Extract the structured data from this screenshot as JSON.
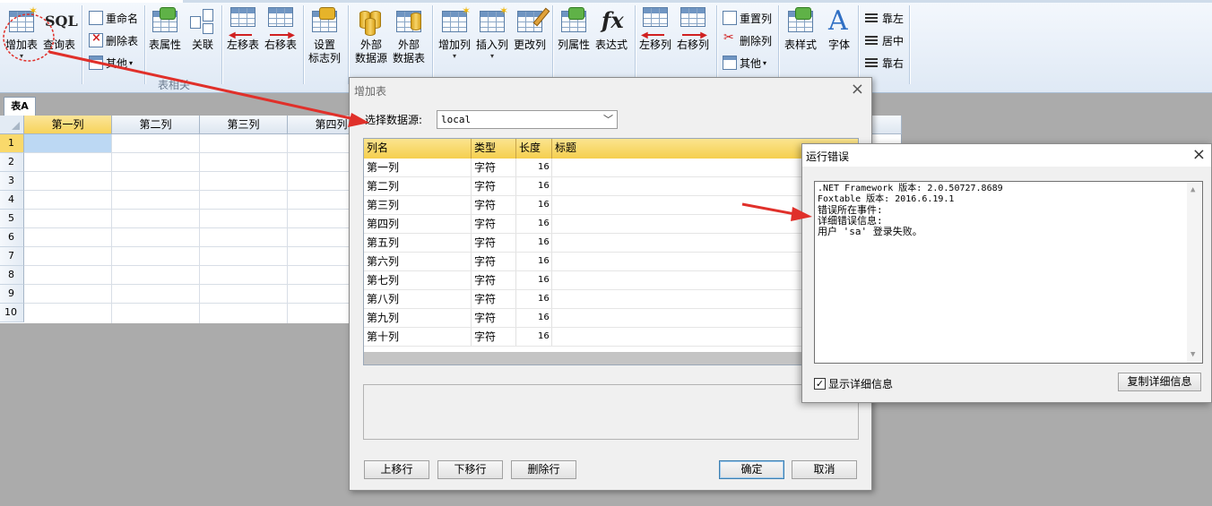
{
  "ribbon": {
    "add_table": "增加表",
    "query_table": "查询表",
    "sql_icon_text": "SQL",
    "rename": "重命名",
    "delete_table": "删除表",
    "other_1": "其他",
    "table_props": "表属性",
    "relation": "关联",
    "move_table_left": "左移表",
    "move_table_right": "右移表",
    "set_flag_col_1": "设置",
    "set_flag_col_2": "标志列",
    "external_source_1": "外部",
    "external_source_2": "数据源",
    "external_table_1": "外部",
    "external_table_2": "数据表",
    "add_column": "增加列",
    "insert_column": "插入列",
    "change_column": "更改列",
    "column_props": "列属性",
    "expression": "表达式",
    "fx_icon_text": "fx",
    "move_col_left": "左移列",
    "move_col_right": "右移列",
    "reset_columns": "重置列",
    "delete_column": "删除列",
    "other_2": "其他",
    "table_style": "表样式",
    "font": "字体",
    "font_icon_text": "A",
    "align_left": "靠左",
    "align_center": "居中",
    "align_right": "靠右",
    "group_table_related": "表相关"
  },
  "sheet": {
    "tab": "表A",
    "columns": [
      "第一列",
      "第二列",
      "第三列",
      "第四列"
    ],
    "rows": [
      "1",
      "2",
      "3",
      "4",
      "5",
      "6",
      "7",
      "8",
      "9",
      "10"
    ]
  },
  "add_table_dialog": {
    "title": "增加表",
    "source_label": "选择数据源:",
    "source_value": "local",
    "headers": [
      "列名",
      "类型",
      "长度",
      "标题"
    ],
    "rows": [
      {
        "name": "第一列",
        "type": "字符",
        "len": "16",
        "title": ""
      },
      {
        "name": "第二列",
        "type": "字符",
        "len": "16",
        "title": ""
      },
      {
        "name": "第三列",
        "type": "字符",
        "len": "16",
        "title": ""
      },
      {
        "name": "第四列",
        "type": "字符",
        "len": "16",
        "title": ""
      },
      {
        "name": "第五列",
        "type": "字符",
        "len": "16",
        "title": ""
      },
      {
        "name": "第六列",
        "type": "字符",
        "len": "16",
        "title": ""
      },
      {
        "name": "第七列",
        "type": "字符",
        "len": "16",
        "title": ""
      },
      {
        "name": "第八列",
        "type": "字符",
        "len": "16",
        "title": ""
      },
      {
        "name": "第九列",
        "type": "字符",
        "len": "16",
        "title": ""
      },
      {
        "name": "第十列",
        "type": "字符",
        "len": "16",
        "title": ""
      }
    ],
    "btn_move_up": "上移行",
    "btn_move_down": "下移行",
    "btn_delete_row": "删除行",
    "btn_ok": "确定",
    "btn_cancel": "取消"
  },
  "error_dialog": {
    "title": "运行错误",
    "lines": [
      ".NET Framework 版本: 2.0.50727.8689",
      "Foxtable 版本: 2016.6.19.1",
      "错误所在事件:",
      "详细错误信息:",
      "用户 'sa' 登录失败。"
    ],
    "show_details_label": "显示详细信息",
    "show_details_checked": true,
    "copy_details_button": "复制详细信息"
  },
  "colors": {
    "header_gold": "#f5cf4e",
    "annotation_red": "#e0302a",
    "selection_blue": "#bcd8f3"
  }
}
